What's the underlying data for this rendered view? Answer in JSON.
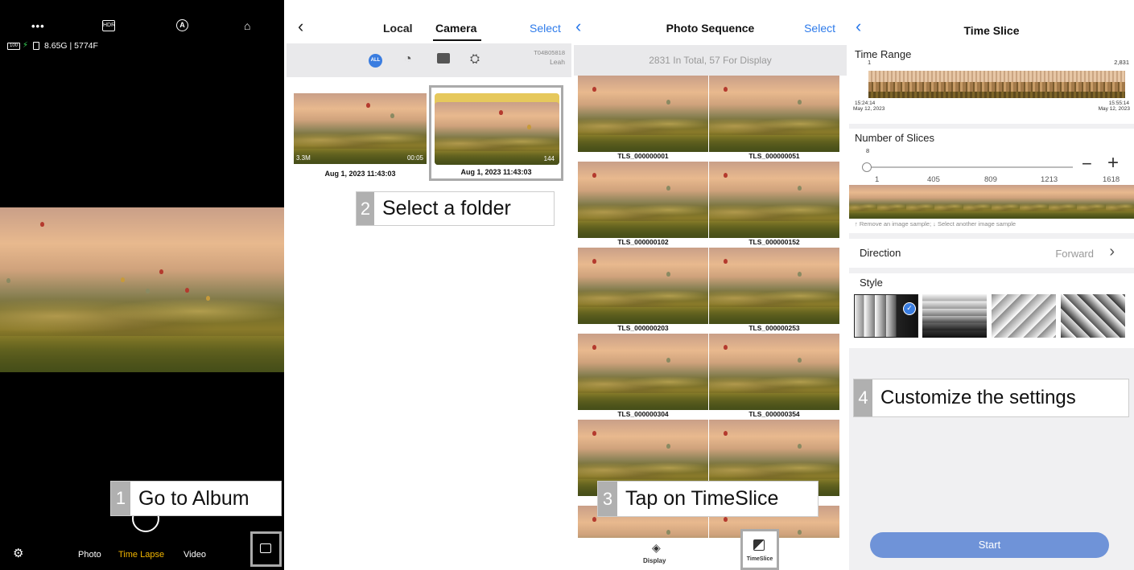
{
  "panel1": {
    "top_icons": [
      "more-icon",
      "hdr-icon",
      "auto-icon",
      "home-icon"
    ],
    "hdr_label": "HDR",
    "status": "8.65G | 5774F",
    "battery": "100",
    "modes": [
      "Photo",
      "Time Lapse",
      "Video"
    ],
    "active_mode": "Time Lapse",
    "callout": {
      "num": "1",
      "text": "Go to Album"
    }
  },
  "panel2": {
    "tabs": [
      "Local",
      "Camera"
    ],
    "active_tab": "Camera",
    "select": "Select",
    "filter_all": "ALL",
    "device_id": "T04B05818",
    "device_user": "Leah",
    "items": [
      {
        "size": "3.3M",
        "duration": "00:05",
        "date": "Aug 1, 2023 11:43:03"
      },
      {
        "count": "144",
        "date": "Aug 1, 2023 11:43:03"
      }
    ],
    "callout": {
      "num": "2",
      "text": "Select a folder"
    }
  },
  "panel3": {
    "title": "Photo Sequence",
    "select": "Select",
    "summary": "2831 In Total,  57 For Display",
    "labels": [
      "TLS_000000001",
      "TLS_000000051",
      "TLS_000000102",
      "TLS_000000152",
      "TLS_000000203",
      "TLS_000000253",
      "TLS_000000304",
      "TLS_000000354"
    ],
    "display_label": "Display",
    "timeslice_label": "TimeSlice",
    "callout": {
      "num": "3",
      "text": "Tap on TimeSlice"
    }
  },
  "panel4": {
    "title": "Time Slice",
    "time_range_label": "Time Range",
    "range_start": "1",
    "range_end": "2,831",
    "start_time": "15:24:14",
    "start_date": "May 12, 2023",
    "end_time": "15:55:14",
    "end_date": "May 12, 2023",
    "slices_label": "Number of Slices",
    "slices_value": "8",
    "slices_ticks": [
      "1",
      "405",
      "809",
      "1213",
      "1618"
    ],
    "hint": "↑ Remove an image sample; ↓ Select another image sample",
    "direction_label": "Direction",
    "direction_value": "Forward",
    "style_label": "Style",
    "start_button": "Start",
    "accent": "#3a7de0",
    "callout": {
      "num": "4",
      "text": "Customize the settings"
    }
  }
}
